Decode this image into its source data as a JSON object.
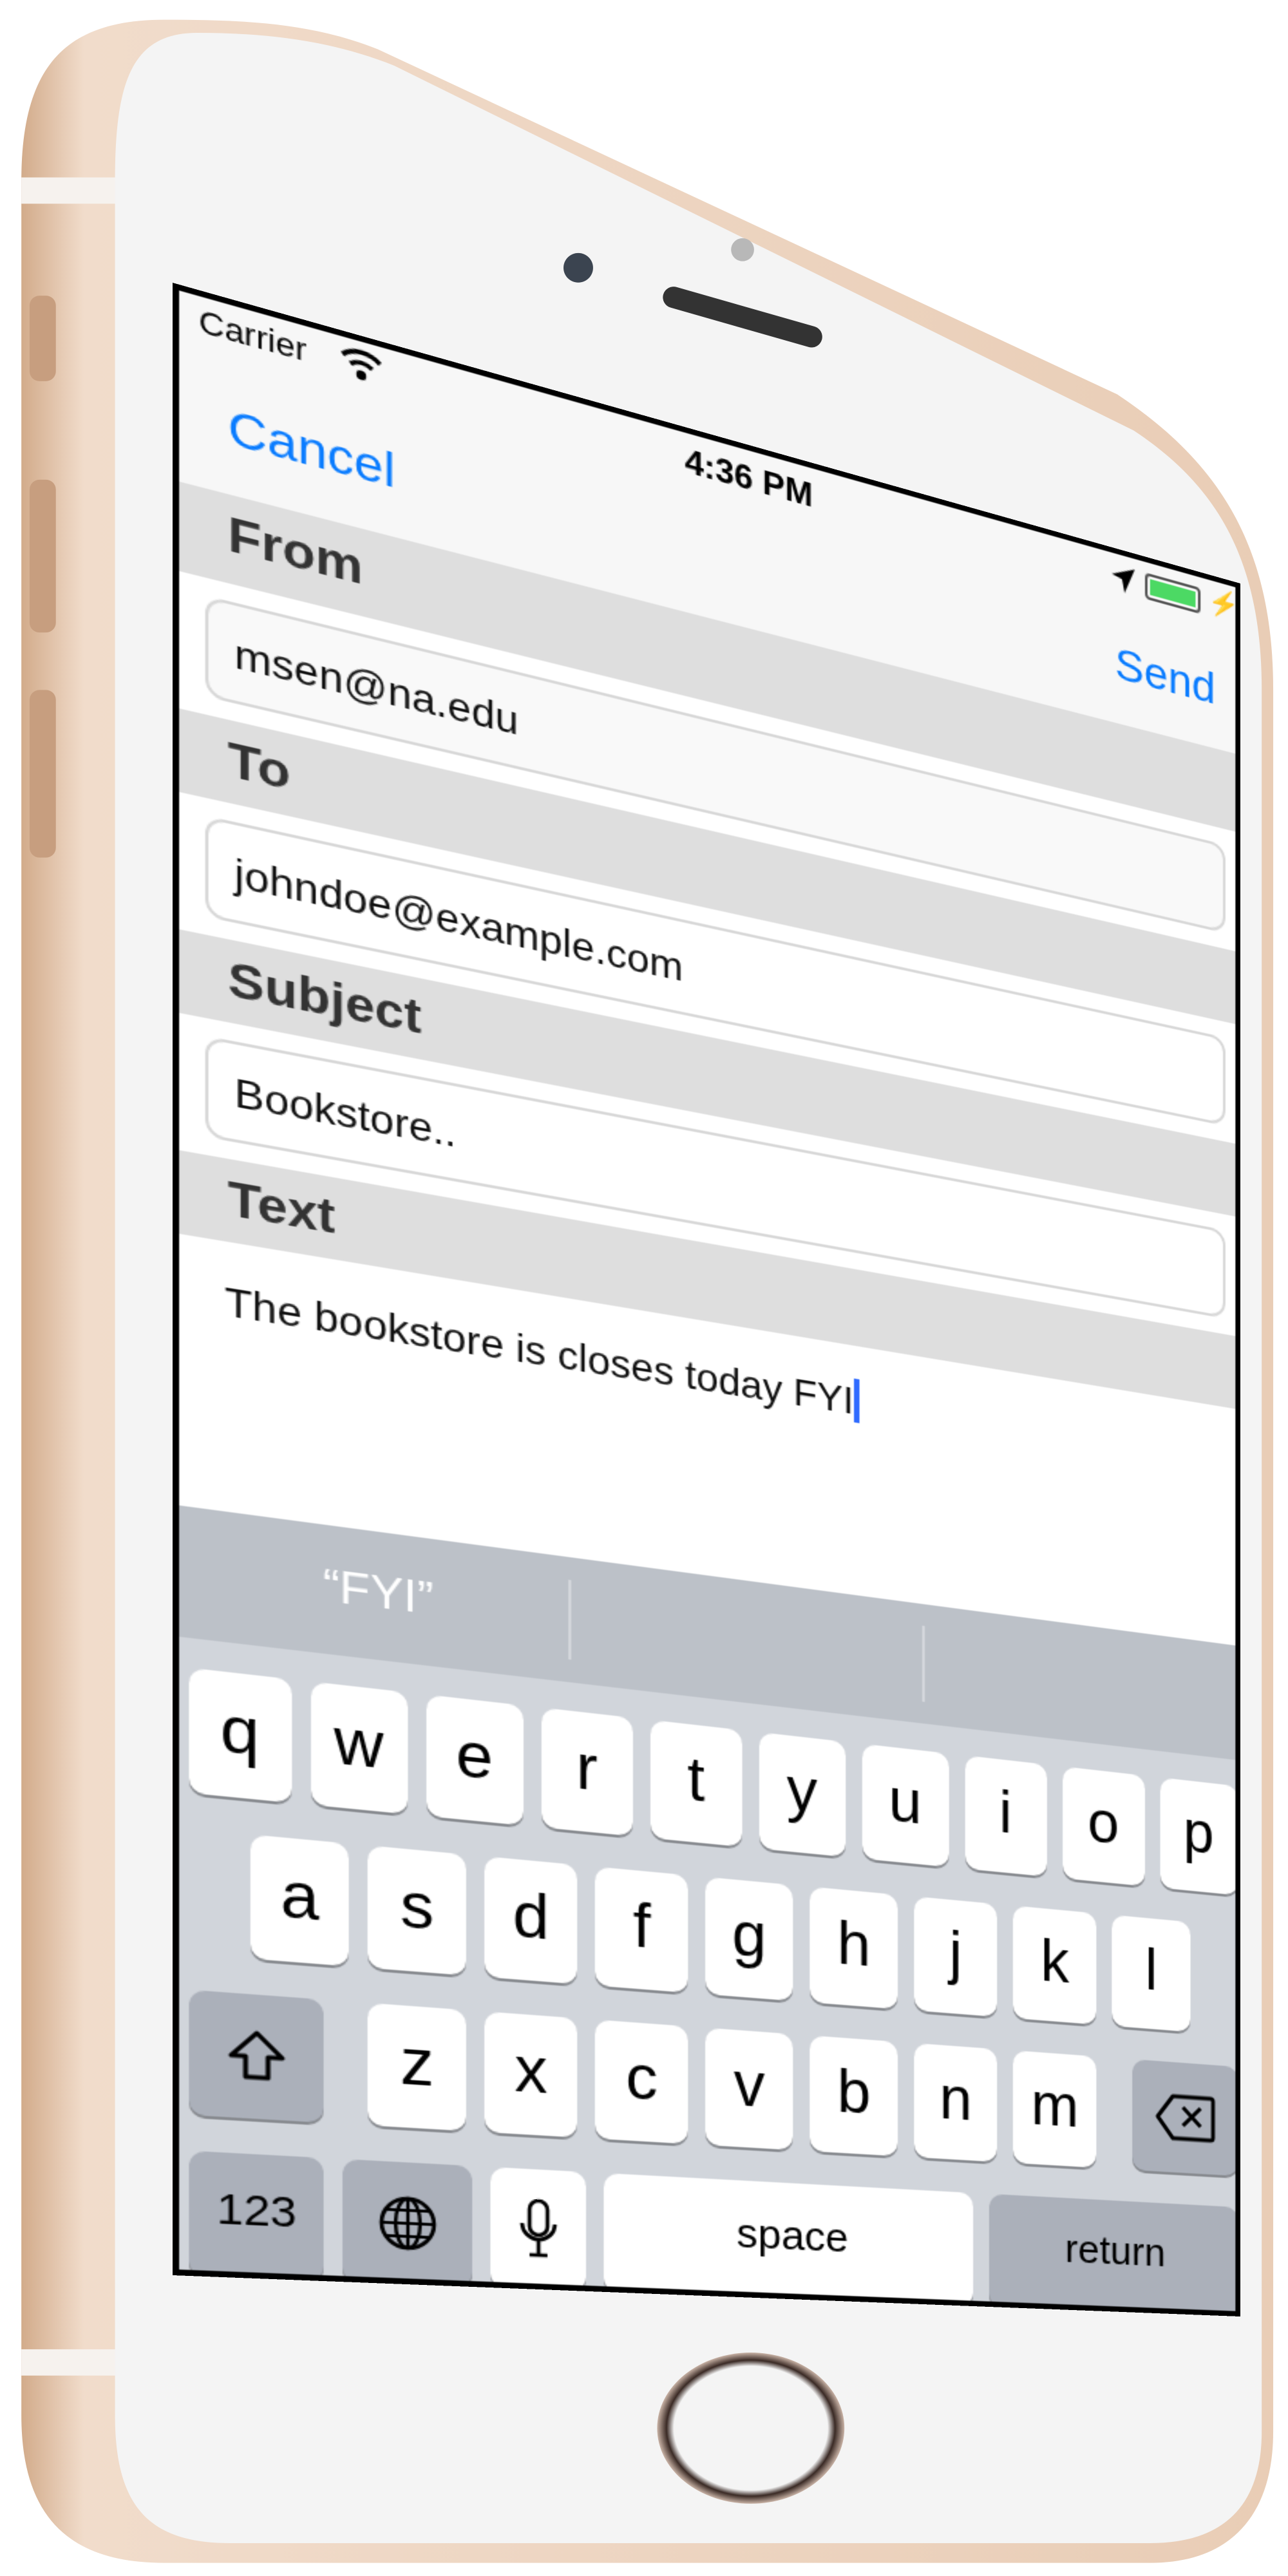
{
  "status_bar": {
    "carrier": "Carrier",
    "time": "4:36 PM",
    "wifi_icon": "wifi-icon",
    "location_icon": "location-arrow-icon",
    "battery_icon": "battery-charging-icon",
    "battery_color": "#4cd964"
  },
  "nav": {
    "cancel_label": "Cancel",
    "send_label": "Send",
    "accent_color": "#0a7cff"
  },
  "form": {
    "from_label": "From",
    "from_value": "msen@na.edu",
    "to_label": "To",
    "to_value": "johndoe@example.com",
    "subject_label": "Subject",
    "subject_value": "Bookstore..",
    "text_label": "Text",
    "text_value": "The bookstore is closes today FYI"
  },
  "keyboard": {
    "suggestions": [
      "“FYI”",
      "",
      ""
    ],
    "row1": [
      "q",
      "w",
      "e",
      "r",
      "t",
      "y",
      "u",
      "i",
      "o",
      "p"
    ],
    "row2": [
      "a",
      "s",
      "d",
      "f",
      "g",
      "h",
      "j",
      "k",
      "l"
    ],
    "row3": [
      "z",
      "x",
      "c",
      "v",
      "b",
      "n",
      "m"
    ],
    "shift_icon": "shift-icon",
    "delete_icon": "delete-icon",
    "numbers_label": "123",
    "globe_icon": "globe-icon",
    "mic_icon": "microphone-icon",
    "space_label": "space",
    "return_label": "return"
  }
}
